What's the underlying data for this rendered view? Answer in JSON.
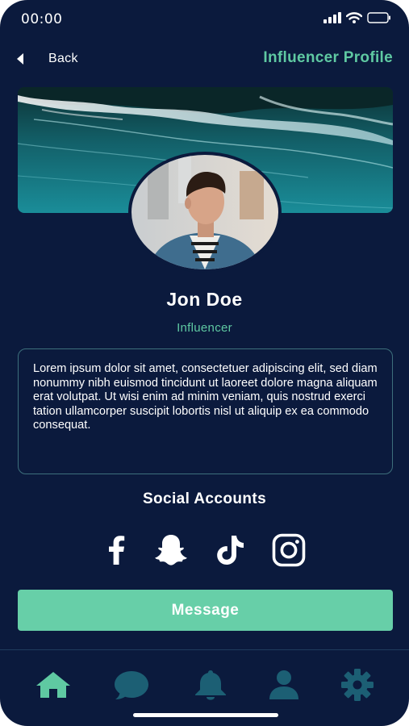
{
  "status_bar": {
    "time": "00:00"
  },
  "header": {
    "back_label": "Back",
    "title": "Influencer Profile"
  },
  "profile": {
    "name": "Jon Doe",
    "role": "Influencer",
    "bio": "Lorem ipsum dolor sit amet, consectetuer adipiscing elit, sed diam nonummy nibh euismod tincidunt ut laoreet dolore magna aliquam erat volutpat. Ut wisi enim ad minim veniam, quis nostrud exerci tation ullamcorper suscipit lobortis nisl ut aliquip ex ea commodo consequat."
  },
  "social": {
    "title": "Social Accounts",
    "icons": [
      "facebook-icon",
      "snapchat-icon",
      "tiktok-icon",
      "instagram-icon"
    ]
  },
  "actions": {
    "message_label": "Message"
  },
  "tab_bar": {
    "active": "home",
    "icons": [
      "home-icon",
      "chat-icon",
      "bell-icon",
      "user-icon",
      "settings-icon"
    ]
  },
  "colors": {
    "background": "#0b1a3d",
    "accent": "#5fc9a2",
    "button": "#67cfa8",
    "inactive_icon": "#1c5f74",
    "border": "#3d6f7c"
  }
}
